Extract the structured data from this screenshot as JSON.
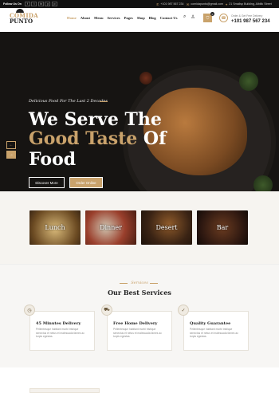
{
  "topbar": {
    "follow_label": "Follow Us On",
    "social": [
      "f",
      "t",
      "in",
      "y",
      "p"
    ],
    "phone": "+101 987 567 234",
    "email": "comidapunto@gmail.com",
    "address": "21 Smallsp Building, Albiitk Street"
  },
  "header": {
    "logo_line1": "COMIDA",
    "logo_line2": "PUNTO",
    "nav": [
      "Home",
      "About",
      "Menu",
      "Services",
      "Pages",
      "Shop",
      "Blog",
      "Contact Us"
    ],
    "cart_count": "0",
    "phone_label": "Order & Get Free Delivery",
    "phone_number": "+101 987 567 234"
  },
  "hero": {
    "tagline": "Delicious Food For The Last 2 Decades",
    "title_line1": "We Serve The",
    "title_line2_gold": "Good Taste",
    "title_line2_rest": " Of",
    "title_line3": "Food",
    "btn_discover": "Discover More",
    "btn_order": "Order Online",
    "prev_arrow": "←",
    "next_arrow": "→"
  },
  "categories": [
    {
      "label": "Lunch"
    },
    {
      "label": "Dinner"
    },
    {
      "label": "Desert"
    },
    {
      "label": "Bar"
    }
  ],
  "services": {
    "subtitle": "Services",
    "title": "Our Best Services",
    "items": [
      {
        "icon": "clock-icon",
        "glyph": "◷",
        "name": "45 Minutes Delivery",
        "desc": "Pellentesque habitant morbi tristique senectus et netus et malesuada fames ac turpis egestas."
      },
      {
        "icon": "delivery-icon",
        "glyph": "⛟",
        "name": "Free Home Delivery",
        "desc": "Pellentesque habitant morbi tristique senectus et netus et malesuada fames ac turpis egestas."
      },
      {
        "icon": "quality-icon",
        "glyph": "✓",
        "name": "Quality Guarantee",
        "desc": "Pellentesque habitant morbi tristique senectus et netus et malesuada fames ac turpis egestas."
      }
    ]
  },
  "colors": {
    "accent": "#c9a26b",
    "dark": "#161412"
  }
}
